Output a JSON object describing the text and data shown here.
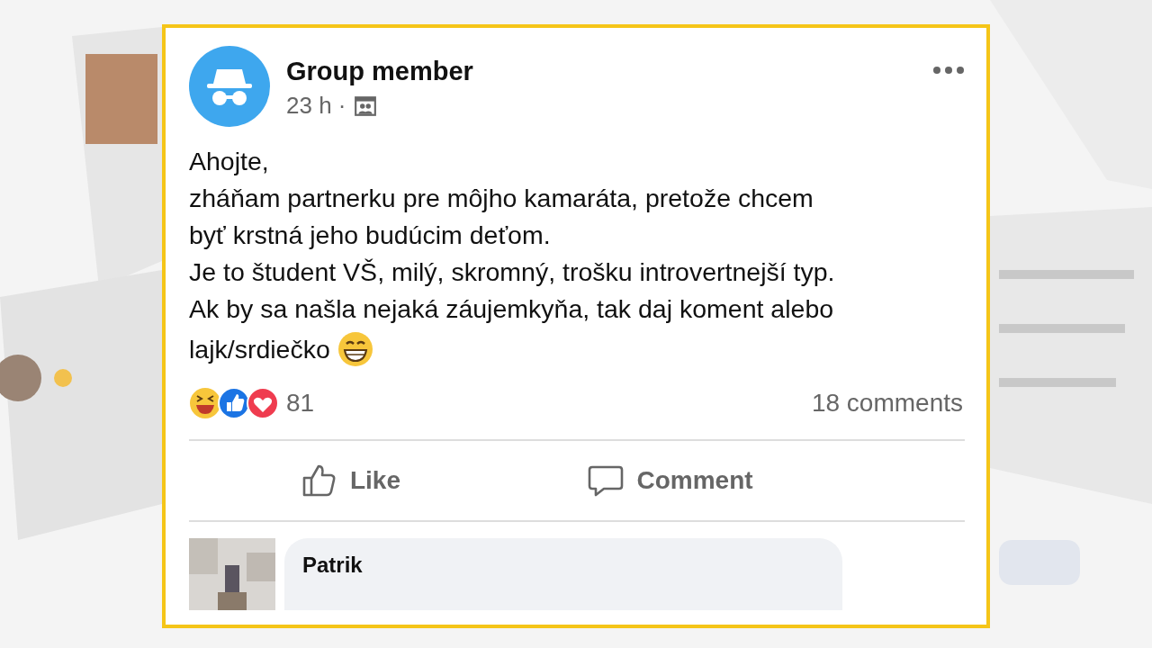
{
  "post": {
    "author": "Group member",
    "time": "23 h ·",
    "lines": [
      "Ahojte,",
      "zháňam partnerku pre môjho kamaráta, pretože chcem",
      "byť krstná jeho budúcim deťom.",
      "Je to študent VŠ, milý, skromný, trošku introvertnejší typ.",
      "Ak by sa našla nejaká záujemkyňa, tak daj koment alebo",
      "lajk/srdiečko"
    ],
    "reaction_count": "81",
    "comments_count": "18 comments",
    "actions": [
      {
        "kind": "like",
        "label": "Like"
      },
      {
        "kind": "comment",
        "label": "Comment"
      }
    ]
  },
  "comments": [
    {
      "author": "Patrik"
    }
  ]
}
